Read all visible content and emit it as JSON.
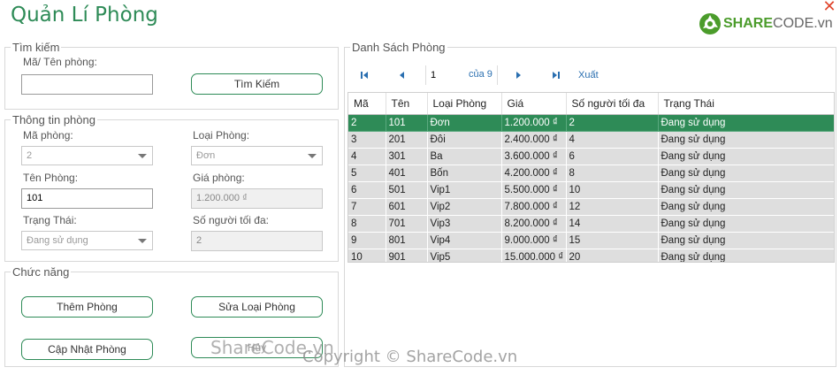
{
  "window": {
    "title": "Quản Lí Phòng",
    "close_glyph": "✕"
  },
  "logo": {
    "brand": "SHARE",
    "suffix": "CODE.vn",
    "icon": "sharecode-logo-icon"
  },
  "search": {
    "legend": "Tìm kiếm",
    "label": "Mã/ Tên phòng:",
    "value": "",
    "button": "Tìm Kiếm"
  },
  "info": {
    "legend": "Thông tin phòng",
    "ma_phong_label": "Mã phòng:",
    "ma_phong_value": "2",
    "loai_phong_label": "Loại Phòng:",
    "loai_phong_value": "Đơn",
    "ten_phong_label": "Tên Phòng:",
    "ten_phong_value": "101",
    "gia_phong_label": "Giá phòng:",
    "gia_phong_value": "1.200.000 ₫",
    "trang_thai_label": "Trạng Thái:",
    "trang_thai_value": "Đang sử dụng",
    "so_nguoi_label": "Số người tối đa:",
    "so_nguoi_value": "2"
  },
  "functions": {
    "legend": "Chức năng",
    "add": "Thêm Phòng",
    "edit_type": "Sửa Loại Phòng",
    "update": "Cập Nhật Phòng",
    "fourth": "Hủy"
  },
  "list": {
    "legend": "Danh Sách Phòng",
    "pager": {
      "page": "1",
      "of": "của 9",
      "export": "Xuất"
    },
    "columns": [
      "Mã",
      "Tên",
      "Loại Phòng",
      "Giá",
      "Số người tối đa",
      "Trạng Thái"
    ],
    "rows": [
      [
        "2",
        "101",
        "Đơn",
        "1.200.000 ₫",
        "2",
        "Đang sử dụng"
      ],
      [
        "3",
        "201",
        "Đôi",
        "2.400.000 ₫",
        "4",
        "Đang sử dụng"
      ],
      [
        "4",
        "301",
        "Ba",
        "3.600.000 ₫",
        "6",
        "Đang sử dụng"
      ],
      [
        "5",
        "401",
        "Bốn",
        "4.200.000 ₫",
        "8",
        "Đang sử dụng"
      ],
      [
        "6",
        "501",
        "Vip1",
        "5.500.000 ₫",
        "10",
        "Đang sử dụng"
      ],
      [
        "7",
        "601",
        "Vip2",
        "7.800.000 ₫",
        "12",
        "Đang sử dụng"
      ],
      [
        "8",
        "701",
        "Vip3",
        "8.200.000 ₫",
        "14",
        "Đang sử dụng"
      ],
      [
        "9",
        "801",
        "Vip4",
        "9.000.000 ₫",
        "15",
        "Đang sử dụng"
      ],
      [
        "10",
        "901",
        "Vip5",
        "15.000.000 ₫",
        "20",
        "Đang sử dụng"
      ]
    ],
    "selected_index": 0
  },
  "watermarks": {
    "overlay": "ShareCode.vn",
    "copyright": "Copyright © ShareCode.vn"
  },
  "colors": {
    "accent": "#2e8b57",
    "close": "#e0452c",
    "link": "#2a6fb0"
  }
}
